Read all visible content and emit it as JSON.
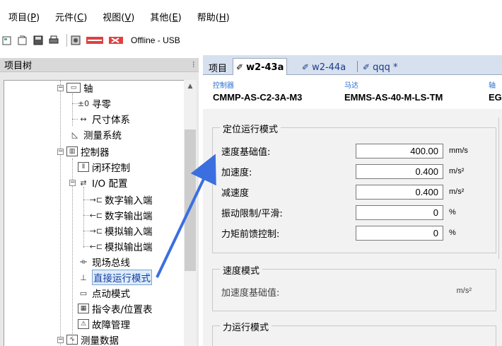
{
  "menubar": {
    "items": [
      {
        "label": "项目",
        "key": "P"
      },
      {
        "label": "元件",
        "key": "C"
      },
      {
        "label": "视图",
        "key": "V"
      },
      {
        "label": "其他",
        "key": "E"
      },
      {
        "label": "帮助",
        "key": "H"
      }
    ]
  },
  "toolbar": {
    "status": "Offline - USB"
  },
  "tree": {
    "title": "项目树",
    "nodes": {
      "axis": "轴",
      "homing": "寻零",
      "dimension": "尺寸体系",
      "measurement": "测量系统",
      "controller": "控制器",
      "closed_loop": "闭环控制",
      "io_config": "I/O 配置",
      "digital_in": "数字输入端",
      "digital_out": "数字输出端",
      "analog_in": "模拟输入端",
      "analog_out": "模拟输出端",
      "fieldbus": "现场总线",
      "direct_mode": "直接运行模式",
      "jog_mode": "点动模式",
      "position_table": "指令表/位置表",
      "fault_mgmt": "故障管理",
      "measure_data": "测量数据"
    },
    "icons": {
      "homing": "±0",
      "dimension": "↔"
    }
  },
  "tabs": {
    "project": "项目",
    "items": [
      {
        "label": "w2-43a",
        "active": true
      },
      {
        "label": "w2-44a",
        "active": false
      },
      {
        "label": "qqq *",
        "active": false
      }
    ]
  },
  "info": {
    "controller_caption": "控制器",
    "controller_value": "CMMP-AS-C2-3A-M3",
    "motor_caption": "马达",
    "motor_value": "EMMS-AS-40-M-LS-TM",
    "axis_caption": "轴",
    "axis_value": "EG"
  },
  "position_mode": {
    "title": "定位运行模式",
    "rows": [
      {
        "label": "速度基础值:",
        "value": "400.00",
        "unit": "mm/s"
      },
      {
        "label": "加速度:",
        "value": "0.400",
        "unit": "m/s²"
      },
      {
        "label": "减速度",
        "value": "0.400",
        "unit": "m/s²"
      },
      {
        "label": "振动限制/平滑:",
        "value": "0",
        "unit": "%"
      },
      {
        "label": "力矩前馈控制:",
        "value": "0",
        "unit": "%"
      }
    ]
  },
  "speed_mode": {
    "title": "速度模式",
    "label": "加速度基础值:",
    "unit": "m/s²"
  },
  "force_mode": {
    "title": "力运行模式"
  },
  "colors": {
    "arrow": "#3b6fe0",
    "selection_bg": "#dcecfc"
  }
}
